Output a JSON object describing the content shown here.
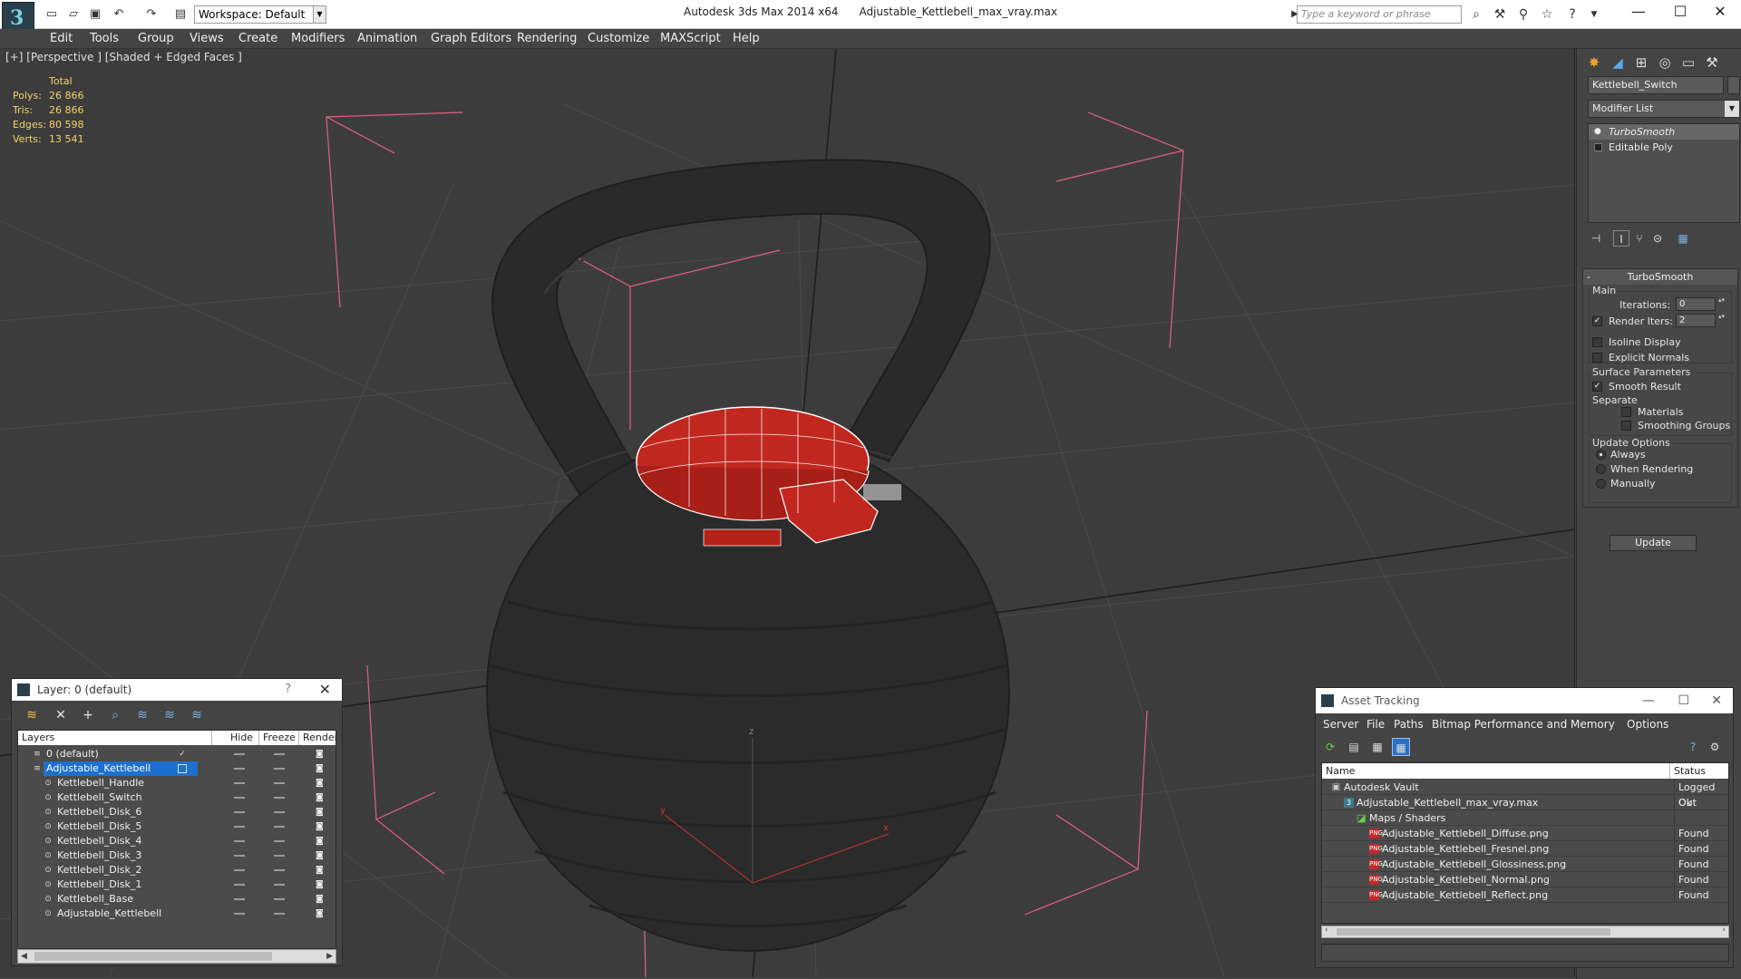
{
  "titlebar": {
    "workspace": "Workspace: Default",
    "app_name": "Autodesk 3ds Max  2014 x64",
    "file_name": "Adjustable_Kettlebell_max_vray.max",
    "search_placeholder": "Type a keyword or phrase",
    "minimize": "—",
    "maximize": "☐",
    "close": "✕"
  },
  "menu": [
    "Edit",
    "Tools",
    "Group",
    "Views",
    "Create",
    "Modifiers",
    "Animation",
    "Graph Editors",
    "Rendering",
    "Customize",
    "MAXScript",
    "Help"
  ],
  "viewport": {
    "label": "[+] [Perspective ] [Shaded + Edged Faces ]",
    "stats_header": "Total",
    "stats": [
      {
        "label": "Polys:",
        "value": "26 866"
      },
      {
        "label": "Tris:",
        "value": "26 866"
      },
      {
        "label": "Edges:",
        "value": "80 598"
      },
      {
        "label": "Verts:",
        "value": "13 541"
      }
    ],
    "axis_x": "x",
    "axis_y": "y",
    "axis_z": "z"
  },
  "command_panel": {
    "object_name": "Kettlebell_Switch",
    "modifier_list": "Modifier List",
    "stack": [
      {
        "label": "TurboSmooth",
        "selected": true
      },
      {
        "label": "Editable Poly",
        "selected": false
      }
    ],
    "rollout_title": "TurboSmooth",
    "main_group": "Main",
    "iterations_label": "Iterations:",
    "iterations_value": "0",
    "render_iters_label": "Render Iters:",
    "render_iters_value": "2",
    "isoline_label": "Isoline Display",
    "explicit_normals_label": "Explicit Normals",
    "surface_group": "Surface Parameters",
    "smooth_result_label": "Smooth Result",
    "separate_label": "Separate",
    "materials_label": "Materials",
    "smoothing_groups_label": "Smoothing Groups",
    "update_group": "Update Options",
    "always_label": "Always",
    "when_rendering_label": "When Rendering",
    "manually_label": "Manually",
    "update_button": "Update"
  },
  "layer_dialog": {
    "title": "Layer: 0 (default)",
    "help": "?",
    "close": "✕",
    "columns": [
      "Layers",
      "Hide",
      "Freeze",
      "Render"
    ],
    "rows": [
      {
        "name": "0 (default)",
        "level": 0,
        "selected": false,
        "current": true
      },
      {
        "name": "Adjustable_Kettlebell",
        "level": 0,
        "selected": true,
        "current": false
      },
      {
        "name": "Kettlebell_Handle",
        "level": 1,
        "selected": false,
        "current": false
      },
      {
        "name": "Kettlebell_Switch",
        "level": 1,
        "selected": false,
        "current": false
      },
      {
        "name": "Kettlebell_Disk_6",
        "level": 1,
        "selected": false,
        "current": false
      },
      {
        "name": "Kettlebell_Disk_5",
        "level": 1,
        "selected": false,
        "current": false
      },
      {
        "name": "Kettlebell_Disk_4",
        "level": 1,
        "selected": false,
        "current": false
      },
      {
        "name": "Kettlebell_Disk_3",
        "level": 1,
        "selected": false,
        "current": false
      },
      {
        "name": "Kettlebell_Disk_2",
        "level": 1,
        "selected": false,
        "current": false
      },
      {
        "name": "Kettlebell_Disk_1",
        "level": 1,
        "selected": false,
        "current": false
      },
      {
        "name": "Kettlebell_Base",
        "level": 1,
        "selected": false,
        "current": false
      },
      {
        "name": "Adjustable_Kettlebell",
        "level": 1,
        "selected": false,
        "current": false
      }
    ]
  },
  "asset_dialog": {
    "title": "Asset Tracking",
    "menu": [
      "Server",
      "File",
      "Paths",
      "Bitmap Performance and Memory",
      "Options"
    ],
    "columns": [
      "Name",
      "Status"
    ],
    "rows": [
      {
        "name": "Autodesk Vault",
        "status": "Logged Out",
        "level": 0,
        "icon": "vault"
      },
      {
        "name": "Adjustable_Kettlebell_max_vray.max",
        "status": "Ok",
        "level": 1,
        "icon": "max"
      },
      {
        "name": "Maps / Shaders",
        "status": "",
        "level": 2,
        "icon": "maps"
      },
      {
        "name": "Adjustable_Kettlebell_Diffuse.png",
        "status": "Found",
        "level": 3,
        "icon": "png"
      },
      {
        "name": "Adjustable_Kettlebell_Fresnel.png",
        "status": "Found",
        "level": 3,
        "icon": "png"
      },
      {
        "name": "Adjustable_Kettlebell_Glossiness.png",
        "status": "Found",
        "level": 3,
        "icon": "png"
      },
      {
        "name": "Adjustable_Kettlebell_Normal.png",
        "status": "Found",
        "level": 3,
        "icon": "png"
      },
      {
        "name": "Adjustable_Kettlebell_Reflect.png",
        "status": "Found",
        "level": 3,
        "icon": "png"
      }
    ]
  },
  "colors": {
    "viewport_bg": "#3c3c3c",
    "stats_text": "#f2d36b",
    "selection_blue": "#1d6fd0",
    "switch_red": "#c0281f",
    "bbox_pink": "#e06080"
  }
}
